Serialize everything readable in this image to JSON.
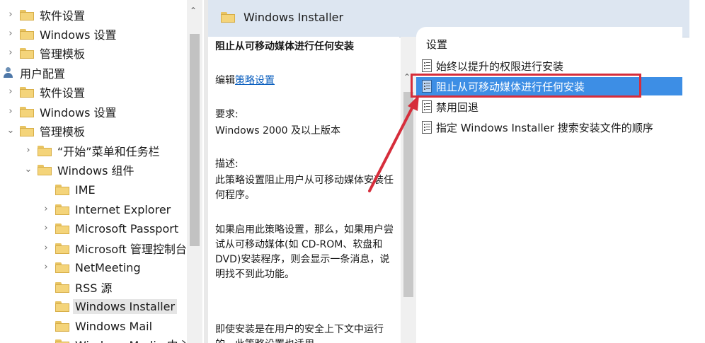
{
  "tree": {
    "items": [
      {
        "label": "软件设置",
        "expander": "collapsed"
      },
      {
        "label": "Windows 设置",
        "expander": "collapsed"
      },
      {
        "label": "管理模板",
        "expander": "collapsed"
      },
      {
        "label": "用户配置",
        "expander": "none",
        "icon": "user-icon"
      },
      {
        "label": "软件设置",
        "expander": "collapsed"
      },
      {
        "label": "Windows 设置",
        "expander": "collapsed"
      },
      {
        "label": "管理模板",
        "expander": "expanded"
      },
      {
        "label": "“开始”菜单和任务栏",
        "expander": "collapsed"
      },
      {
        "label": "Windows 组件",
        "expander": "expanded"
      },
      {
        "label": "IME",
        "expander": "none"
      },
      {
        "label": "Internet Explorer",
        "expander": "collapsed"
      },
      {
        "label": "Microsoft Passport",
        "expander": "collapsed"
      },
      {
        "label": "Microsoft 管理控制台",
        "expander": "collapsed"
      },
      {
        "label": "NetMeeting",
        "expander": "collapsed"
      },
      {
        "label": "RSS 源",
        "expander": "none"
      },
      {
        "label": "Windows Installer",
        "expander": "none",
        "selected": true
      },
      {
        "label": "Windows Mail",
        "expander": "none"
      },
      {
        "label": "Windows Media 中心",
        "expander": "none"
      }
    ]
  },
  "header": {
    "title": "Windows Installer"
  },
  "description": {
    "policy_title": "阻止从可移动媒体进行任何安装",
    "edit_prefix": "编辑",
    "edit_link": "策略设置",
    "requirements_label": "要求:",
    "requirements_value": "Windows 2000 及以上版本",
    "description_label": "描述:",
    "description_text": "此策略设置阻止用户从可移动媒体安装任何程序。",
    "enabled_text": "如果启用此策略设置，那么，如果用户尝试从可移动媒体(如 CD-ROM、软盘和 DVD)安装程序，则会显示一条消息，说明找不到此功能。",
    "extra_text": "即使安装是在用户的安全上下文中运行的，此策略设置也适用"
  },
  "settings": {
    "column_header": "设置",
    "items": [
      {
        "label": "始终以提升的权限进行安装"
      },
      {
        "label": "阻止从可移动媒体进行任何安装",
        "selected": true
      },
      {
        "label": "禁用回退"
      },
      {
        "label": "指定 Windows Installer 搜索安装文件的顺序"
      }
    ]
  },
  "colors": {
    "selection": "#3d8ee5",
    "annotation": "#d62d3b",
    "header_bg": "#dde6f1",
    "link": "#0b5fbf"
  }
}
